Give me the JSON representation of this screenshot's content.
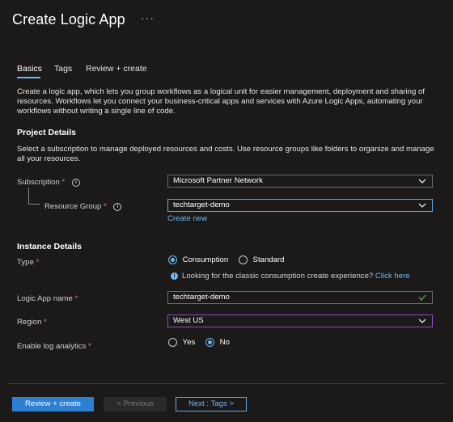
{
  "page": {
    "title": "Create Logic App",
    "more": "···"
  },
  "tabs": [
    {
      "label": "Basics"
    },
    {
      "label": "Tags"
    },
    {
      "label": "Review + create"
    }
  ],
  "intro": "Create a logic app, which lets you group workflows as a logical unit for easier management, deployment and sharing of resources. Workflows let you connect your business-critical apps and services with Azure Logic Apps, automating your workflows without writing a single line of code.",
  "project": {
    "heading": "Project Details",
    "description": "Select a subscription to manage deployed resources and costs. Use resource groups like folders to organize and manage all your resources.",
    "subscription_label": "Subscription",
    "subscription_value": "Microsoft Partner Network",
    "resource_group_label": "Resource Group",
    "resource_group_value": "techtarget-demo",
    "create_new": "Create new"
  },
  "instance": {
    "heading": "Instance Details",
    "type_label": "Type",
    "type_options": [
      "Consumption",
      "Standard"
    ],
    "type_selected": "Consumption",
    "classic_text": "Looking for the classic consumption create experience?",
    "classic_link": "Click here",
    "name_label": "Logic App name",
    "name_value": "techtarget-demo",
    "region_label": "Region",
    "region_value": "West US",
    "log_label": "Enable log analytics",
    "log_options": [
      "Yes",
      "No"
    ],
    "log_selected": "No"
  },
  "required_mark": "*",
  "footer": {
    "review_create": "Review + create",
    "previous": "< Previous",
    "next": "Next : Tags >"
  },
  "colors": {
    "background": "#1b1a19",
    "accent": "#6cb8f6",
    "primary_button": "#2d7fd1",
    "required": "#f1707b",
    "valid_check": "#57a64a",
    "region_border": "#8a4fbf"
  }
}
